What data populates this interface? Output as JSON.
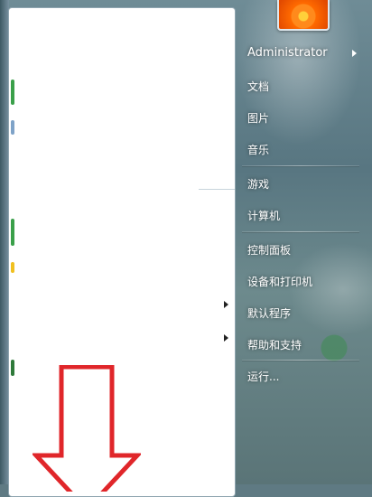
{
  "start_menu": {
    "user_name": "Administrator",
    "right_items": [
      {
        "label": "文档"
      },
      {
        "label": "图片"
      },
      {
        "label": "音乐"
      },
      {
        "label": "游戏"
      },
      {
        "label": "计算机"
      },
      {
        "label": "控制面板"
      },
      {
        "label": "设备和打印机"
      },
      {
        "label": "默认程序"
      },
      {
        "label": "帮助和支持"
      },
      {
        "label": "运行..."
      }
    ],
    "user_picture_icon": "orange-flower-icon",
    "submenu_arrow_icon": "chevron-right-icon"
  },
  "annotation": {
    "arrow_color": "#e0262a",
    "arrow_icon": "down-arrow-icon"
  },
  "colors": {
    "menu_text": "#ffffff",
    "pane_background": "#ffffff"
  }
}
